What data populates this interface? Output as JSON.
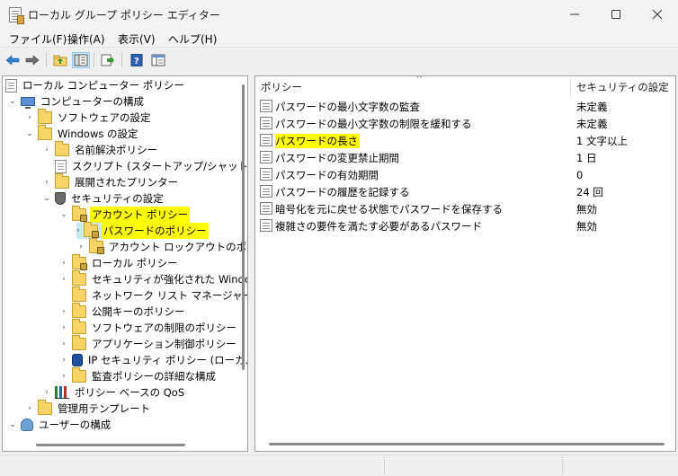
{
  "window": {
    "title": "ローカル グループ ポリシー エディター"
  },
  "menubar": {
    "items": [
      {
        "label": "ファイル(F)"
      },
      {
        "label": "操作(A)"
      },
      {
        "label": "表示(V)"
      },
      {
        "label": "ヘルプ(H)"
      }
    ]
  },
  "toolbar": {
    "buttons": [
      "back-arrow-icon",
      "forward-arrow-icon",
      "up-folder-icon",
      "show-hide-tree-icon",
      "export-list-icon",
      "help-icon",
      "properties-icon"
    ]
  },
  "tree": {
    "items": [
      {
        "label": "ローカル コンピューター ポリシー"
      },
      {
        "label": "コンピューターの構成"
      },
      {
        "label": "ソフトウェアの設定"
      },
      {
        "label": "Windows の設定"
      },
      {
        "label": "名前解決ポリシー"
      },
      {
        "label": "スクリプト (スタートアップ/シャットダウン)"
      },
      {
        "label": "展開されたプリンター"
      },
      {
        "label": "セキュリティの設定"
      },
      {
        "label": "アカウント ポリシー"
      },
      {
        "label": "パスワードのポリシー"
      },
      {
        "label": "アカウント ロックアウトのポリシー"
      },
      {
        "label": "ローカル ポリシー"
      },
      {
        "label": "セキュリティが強化された Windows Defender ファイアウォール"
      },
      {
        "label": "ネットワーク リスト マネージャー ポリシー"
      },
      {
        "label": "公開キーのポリシー"
      },
      {
        "label": "ソフトウェアの制限のポリシー"
      },
      {
        "label": "アプリケーション制御ポリシー"
      },
      {
        "label": "IP セキュリティ ポリシー (ローカル コンピューター)"
      },
      {
        "label": "監査ポリシーの詳細な構成"
      },
      {
        "label": "ポリシー ベースの QoS"
      },
      {
        "label": "管理用テンプレート"
      },
      {
        "label": "ユーザーの構成"
      }
    ]
  },
  "policies": {
    "columns": {
      "policy": "ポリシー",
      "setting": "セキュリティの設定"
    },
    "rows": [
      {
        "name": "パスワードの最小文字数の監査",
        "value": "未定義"
      },
      {
        "name": "パスワードの最小文字数の制限を緩和する",
        "value": "未定義"
      },
      {
        "name": "パスワードの長さ",
        "value": "1 文字以上"
      },
      {
        "name": "パスワードの変更禁止期間",
        "value": "1 日"
      },
      {
        "name": "パスワードの有効期間",
        "value": "0"
      },
      {
        "name": "パスワードの履歴を記録する",
        "value": "24 回"
      },
      {
        "name": "暗号化を元に戻せる状態でパスワードを保存する",
        "value": "無効"
      },
      {
        "name": "複雑さの要件を満たす必要があるパスワード",
        "value": "無効"
      }
    ]
  },
  "colors": {
    "highlight": "#ffff00",
    "selection": "#cce8ff"
  }
}
